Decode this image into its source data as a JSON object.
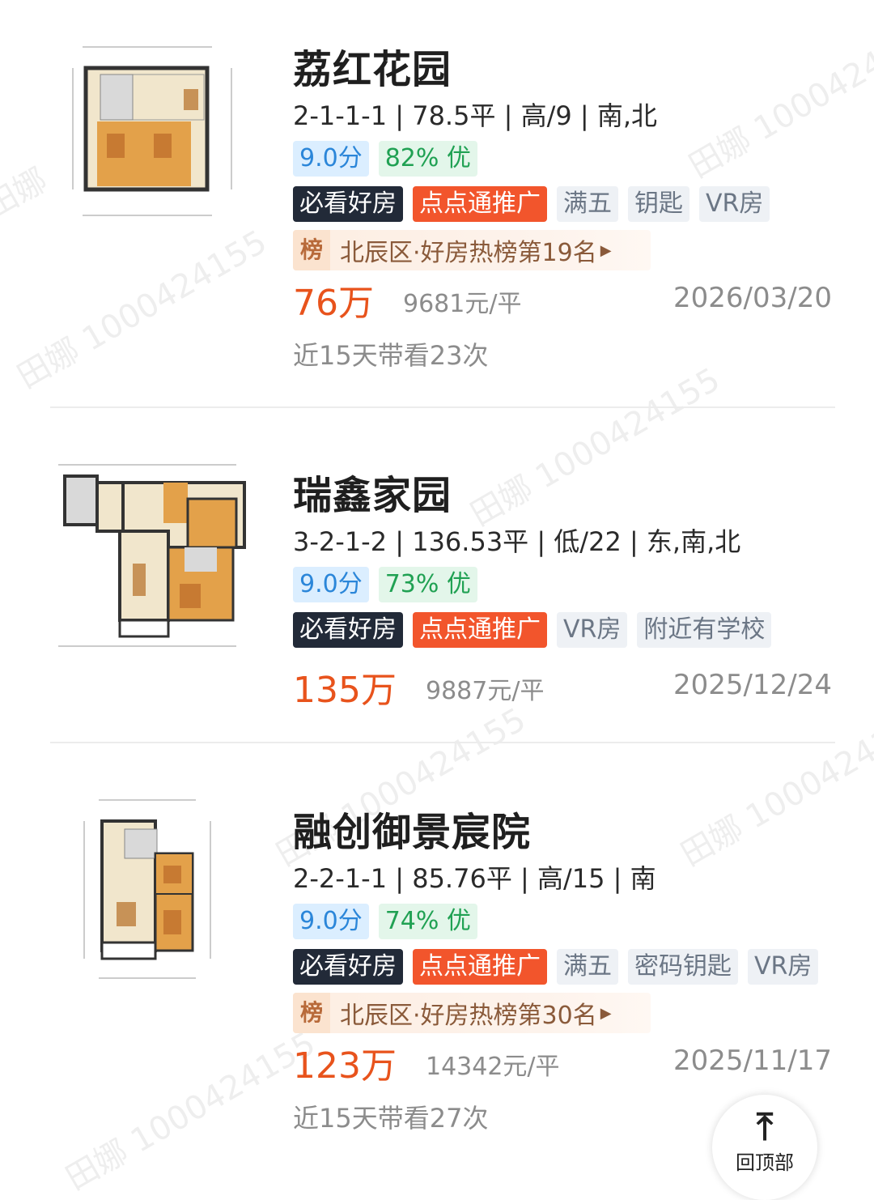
{
  "listings": [
    {
      "title": "荔红花园",
      "specs": "2-1-1-1 | 78.5平 | 高/9 | 南,北",
      "score": "9.0分",
      "quality": "82% 优",
      "tags": [
        "必看好房",
        "点点通推广",
        "满五",
        "钥匙",
        "VR房"
      ],
      "rank_badge": "榜",
      "rank_text": "北辰区·好房热榜第19名",
      "price": "76万",
      "unit_price": "9681元/平",
      "date": "2026/03/20",
      "views": "近15天带看23次"
    },
    {
      "title": "瑞鑫家园",
      "specs": "3-2-1-2 | 136.53平 | 低/22 | 东,南,北",
      "score": "9.0分",
      "quality": "73% 优",
      "tags": [
        "必看好房",
        "点点通推广",
        "VR房",
        "附近有学校"
      ],
      "price": "135万",
      "unit_price": "9887元/平",
      "date": "2025/12/24"
    },
    {
      "title": "融创御景宸院",
      "specs": "2-2-1-1 | 85.76平 | 高/15 | 南",
      "score": "9.0分",
      "quality": "74% 优",
      "tags": [
        "必看好房",
        "点点通推广",
        "满五",
        "密码钥匙",
        "VR房"
      ],
      "rank_badge": "榜",
      "rank_text": "北辰区·好房热榜第30名",
      "price": "123万",
      "unit_price": "14342元/平",
      "date": "2025/11/17",
      "views": "近15天带看27次"
    }
  ],
  "back_to_top": {
    "label": "回顶部"
  },
  "watermark": "田娜 1000424155",
  "colors": {
    "price": "#e8531c",
    "score": "#2b86d9",
    "quality": "#20a153",
    "must": "#222a38",
    "promo": "#f2552c"
  }
}
